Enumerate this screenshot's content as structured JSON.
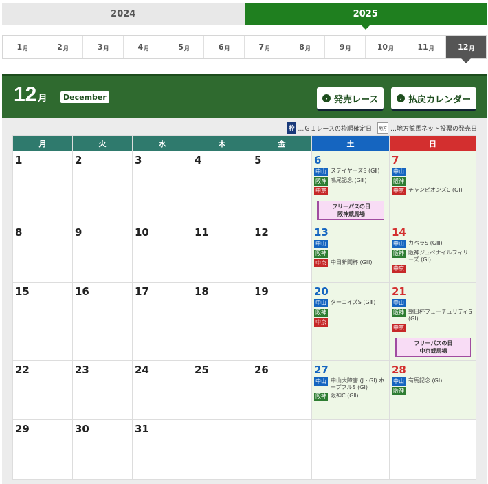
{
  "years": [
    {
      "label": "2024",
      "active": false
    },
    {
      "label": "2025",
      "active": true
    }
  ],
  "months": [
    {
      "n": "1",
      "u": "月"
    },
    {
      "n": "2",
      "u": "月"
    },
    {
      "n": "3",
      "u": "月"
    },
    {
      "n": "4",
      "u": "月"
    },
    {
      "n": "5",
      "u": "月"
    },
    {
      "n": "6",
      "u": "月"
    },
    {
      "n": "7",
      "u": "月"
    },
    {
      "n": "8",
      "u": "月"
    },
    {
      "n": "9",
      "u": "月"
    },
    {
      "n": "10",
      "u": "月"
    },
    {
      "n": "11",
      "u": "月"
    },
    {
      "n": "12",
      "u": "月"
    }
  ],
  "active_month": "12",
  "header": {
    "month": "12",
    "unit": "月",
    "english": "December",
    "btn_sale": "発売レース",
    "btn_refund": "払戻カレンダー"
  },
  "legend": {
    "key_label": "枠",
    "key_text": "…ＧＩレースの枠順確定日",
    "chiho_label": "地方",
    "chiho_text": "…地方競馬ネット投票の発売日"
  },
  "weekdays": [
    "月",
    "火",
    "水",
    "木",
    "金",
    "土",
    "日"
  ],
  "weeks": [
    [
      {
        "d": "1"
      },
      {
        "d": "2"
      },
      {
        "d": "3"
      },
      {
        "d": "4"
      },
      {
        "d": "5"
      },
      {
        "d": "6",
        "ev": [
          {
            "v": "中山",
            "c": "b",
            "t": "ステイヤーズS (GⅡ)"
          },
          {
            "v": "阪神",
            "c": "g",
            "t": "鳴尾記念 (GⅢ)"
          },
          {
            "v": "中京",
            "c": "r",
            "t": ""
          }
        ],
        "fp": [
          "フリーパスの日",
          "阪神競馬場"
        ]
      },
      {
        "d": "7",
        "ev": [
          {
            "v": "中山",
            "c": "b",
            "t": ""
          },
          {
            "v": "阪神",
            "c": "g",
            "t": ""
          },
          {
            "v": "中京",
            "c": "r",
            "t": "チャンピオンズC (GⅠ)"
          }
        ]
      }
    ],
    [
      {
        "d": "8"
      },
      {
        "d": "9"
      },
      {
        "d": "10"
      },
      {
        "d": "11"
      },
      {
        "d": "12"
      },
      {
        "d": "13",
        "ev": [
          {
            "v": "中山",
            "c": "b",
            "t": ""
          },
          {
            "v": "阪神",
            "c": "g",
            "t": ""
          },
          {
            "v": "中京",
            "c": "r",
            "t": "中日新聞杯 (GⅢ)"
          }
        ]
      },
      {
        "d": "14",
        "ev": [
          {
            "v": "中山",
            "c": "b",
            "t": "カペラS (GⅢ)"
          },
          {
            "v": "阪神",
            "c": "g",
            "t": "阪神ジュベナイルフィリーズ (GⅠ)"
          },
          {
            "v": "中京",
            "c": "r",
            "t": ""
          }
        ]
      }
    ],
    [
      {
        "d": "15"
      },
      {
        "d": "16"
      },
      {
        "d": "17"
      },
      {
        "d": "18"
      },
      {
        "d": "19"
      },
      {
        "d": "20",
        "ev": [
          {
            "v": "中山",
            "c": "b",
            "t": "ターコイズS (GⅢ)"
          },
          {
            "v": "阪神",
            "c": "g",
            "t": ""
          },
          {
            "v": "中京",
            "c": "r",
            "t": ""
          }
        ]
      },
      {
        "d": "21",
        "ev": [
          {
            "v": "中山",
            "c": "b",
            "t": ""
          },
          {
            "v": "阪神",
            "c": "g",
            "t": "朝日杯フューチュリティS (GⅠ)"
          },
          {
            "v": "中京",
            "c": "r",
            "t": ""
          }
        ],
        "fp": [
          "フリーパスの日",
          "中京競馬場"
        ]
      }
    ],
    [
      {
        "d": "22"
      },
      {
        "d": "23"
      },
      {
        "d": "24"
      },
      {
        "d": "25"
      },
      {
        "d": "26"
      },
      {
        "d": "27",
        "ev": [
          {
            "v": "中山",
            "c": "b",
            "t": "中山大障害 (J・GⅠ) ホープフルS (GⅠ)"
          },
          {
            "v": "阪神",
            "c": "g",
            "t": "阪神C (GⅡ)"
          }
        ]
      },
      {
        "d": "28",
        "ev": [
          {
            "v": "中山",
            "c": "b",
            "t": "有馬記念 (GⅠ)"
          },
          {
            "v": "阪神",
            "c": "g",
            "t": ""
          }
        ]
      }
    ],
    [
      {
        "d": "29"
      },
      {
        "d": "30"
      },
      {
        "d": "31"
      },
      {
        "d": ""
      },
      {
        "d": ""
      },
      {
        "d": ""
      },
      {
        "d": ""
      }
    ]
  ]
}
